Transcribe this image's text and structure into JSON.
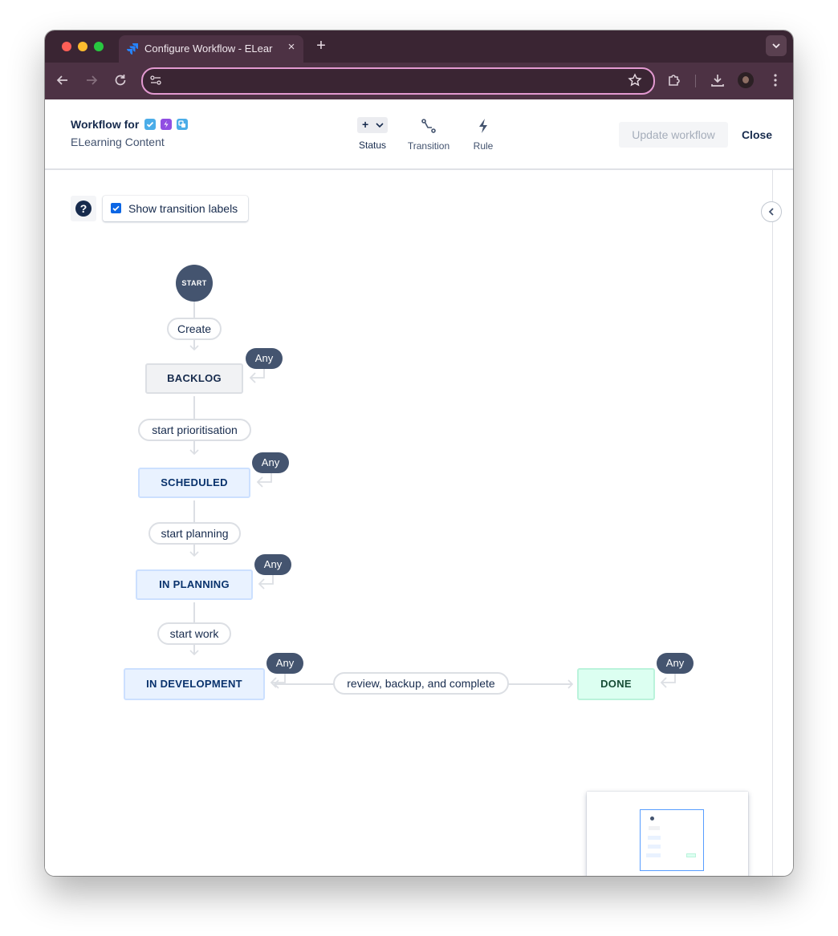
{
  "browser": {
    "tab_title": "Configure Workflow - ELearning Content",
    "tab_close": "×",
    "new_tab": "+",
    "url": ""
  },
  "header": {
    "workflow_for": "Workflow for",
    "project_name": "ELearning Content",
    "tools": {
      "status": "Status",
      "status_plus": "+",
      "transition": "Transition",
      "rule": "Rule"
    },
    "update_button": "Update workflow",
    "close_button": "Close"
  },
  "canvas": {
    "help": "?",
    "show_labels": "Show transition labels",
    "show_labels_checked": true
  },
  "workflow": {
    "start": "START",
    "create": "Create",
    "any": "Any",
    "statuses": {
      "backlog": "BACKLOG",
      "scheduled": "SCHEDULED",
      "in_planning": "IN PLANNING",
      "in_development": "IN DEVELOPMENT",
      "done": "DONE"
    },
    "transitions": {
      "start_prioritisation": "start prioritisation",
      "start_planning": "start planning",
      "start_work": "start work",
      "review_backup_complete": "review, backup, and complete"
    }
  },
  "colors": {
    "accent": "#0c66e4",
    "node_dark": "#44546f",
    "done_green": "#dcfff1"
  }
}
